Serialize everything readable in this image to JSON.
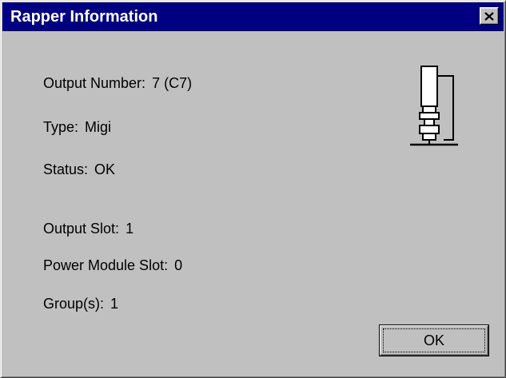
{
  "window": {
    "title": "Rapper Information",
    "close_glyph": "×",
    "icon": "close-icon"
  },
  "info": {
    "output_number": {
      "label": "Output Number:",
      "value": "7  (C7)"
    },
    "type": {
      "label": "Type:",
      "value": "Migi"
    },
    "status": {
      "label": "Status:",
      "value": "OK"
    },
    "output_slot": {
      "label": "Output Slot:",
      "value": "1"
    },
    "power_module_slot": {
      "label": "Power Module Slot:",
      "value": "0"
    },
    "groups": {
      "label": "Group(s):",
      "value": "1"
    }
  },
  "device_icon": "rapper-device-icon",
  "buttons": {
    "ok_label": "OK"
  },
  "colors": {
    "titlebar": "#000080",
    "face": "#c0c0c0",
    "title_text": "#ffffff"
  }
}
